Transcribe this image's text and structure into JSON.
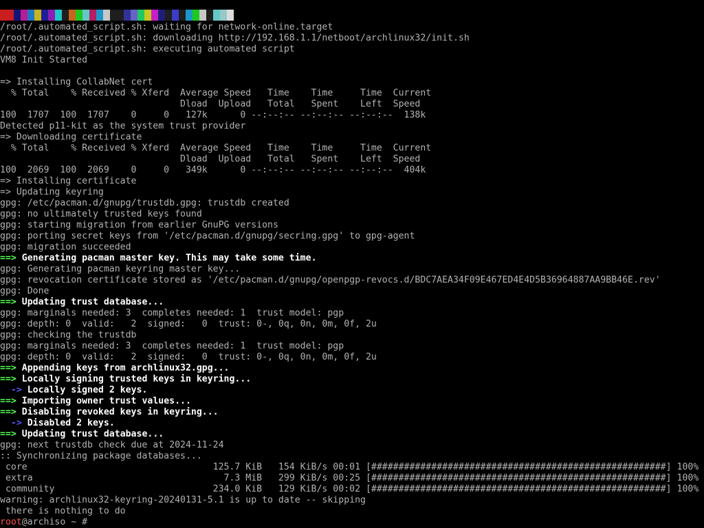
{
  "screen": {
    "background": "#000000",
    "foreground": "#b2b2b2",
    "colors": {
      "arrow_green": "#54ff54",
      "arrow_blue": "#5454ff",
      "bold_white": "#ffffff",
      "prompt_red": "#ff5454"
    }
  },
  "boot_color_bar": [
    "#c81e1e",
    "#c81e1e",
    "#141478",
    "#b41e96",
    "#1e78c8",
    "#c8b41e",
    "#1e1e96",
    "#8c1eb4",
    "#1ec8c8",
    "#1e1e1e",
    "#c8641e",
    "#1ec81e",
    "#64c8c8",
    "#b41e64",
    "#1e96c8",
    "#c8c8c8",
    "#1e1e1e",
    "#1e1e1e",
    "#323296",
    "#6464c8",
    "#1ec864",
    "#c8c81e",
    "#c81ec8",
    "#1e1e78",
    "#1e1e1e",
    "#3c3cc8",
    "#1e1e1e",
    "#1e96c8",
    "#1ec81e",
    "#c8c8c8",
    "#1e1e1e",
    "#64c8c8",
    "#96c8c8",
    "#dcdcdc"
  ],
  "lines": [
    {
      "t": "/root/.automated_script.sh: waiting for network-online.target"
    },
    {
      "t": "/root/.automated_script.sh: downloading http://192.168.1.1/netboot/archlinux32/init.sh"
    },
    {
      "t": "/root/.automated_script.sh: executing automated script"
    },
    {
      "t": "VM8 Init Started"
    },
    {
      "t": ""
    },
    {
      "t": "=> Installing CollabNet cert"
    },
    {
      "t": "  % Total    % Received % Xferd  Average Speed   Time    Time     Time  Current"
    },
    {
      "t": "                                 Dload  Upload   Total   Spent    Left  Speed"
    },
    {
      "t": "100  1707  100  1707    0     0   127k      0 --:--:-- --:--:-- --:--:--  138k"
    },
    {
      "t": "Detected p11-kit as the system trust provider"
    },
    {
      "t": "=> Downloading certificate"
    },
    {
      "t": "  % Total    % Received % Xferd  Average Speed   Time    Time     Time  Current"
    },
    {
      "t": "                                 Dload  Upload   Total   Spent    Left  Speed"
    },
    {
      "t": "100  2069  100  2069    0     0   349k      0 --:--:-- --:--:-- --:--:--  404k"
    },
    {
      "t": "=> Installing certificate"
    },
    {
      "t": "=> Updating keyring"
    },
    {
      "t": "gpg: /etc/pacman.d/gnupg/trustdb.gpg: trustdb created"
    },
    {
      "t": "gpg: no ultimately trusted keys found"
    },
    {
      "t": "gpg: starting migration from earlier GnuPG versions"
    },
    {
      "t": "gpg: porting secret keys from '/etc/pacman.d/gnupg/secring.gpg' to gpg-agent"
    },
    {
      "t": "gpg: migration succeeded"
    },
    {
      "p": "==>",
      "pc": "g",
      "t": " Generating pacman master key. This may take some time.",
      "tc": "b"
    },
    {
      "t": "gpg: Generating pacman keyring master key..."
    },
    {
      "t": "gpg: revocation certificate stored as '/etc/pacman.d/gnupg/openpgp-revocs.d/BDC7AEA34F09E467ED4E4D5B36964887AA9BB46E.rev'"
    },
    {
      "t": "gpg: Done"
    },
    {
      "p": "==>",
      "pc": "g",
      "t": " Updating trust database...",
      "tc": "b"
    },
    {
      "t": "gpg: marginals needed: 3  completes needed: 1  trust model: pgp"
    },
    {
      "t": "gpg: depth: 0  valid:   2  signed:   0  trust: 0-, 0q, 0n, 0m, 0f, 2u"
    },
    {
      "t": "gpg: checking the trustdb"
    },
    {
      "t": "gpg: marginals needed: 3  completes needed: 1  trust model: pgp"
    },
    {
      "t": "gpg: depth: 0  valid:   2  signed:   0  trust: 0-, 0q, 0n, 0m, 0f, 2u"
    },
    {
      "p": "==>",
      "pc": "g",
      "t": " Appending keys from archlinux32.gpg...",
      "tc": "b"
    },
    {
      "p": "==>",
      "pc": "g",
      "t": " Locally signing trusted keys in keyring...",
      "tc": "b"
    },
    {
      "pre": "  ",
      "p": "->",
      "pc": "bl",
      "t": " Locally signed 2 keys.",
      "tc": "b"
    },
    {
      "p": "==>",
      "pc": "g",
      "t": " Importing owner trust values...",
      "tc": "b"
    },
    {
      "p": "==>",
      "pc": "g",
      "t": " Disabling revoked keys in keyring...",
      "tc": "b"
    },
    {
      "pre": "  ",
      "p": "->",
      "pc": "bl",
      "t": " Disabled 2 keys.",
      "tc": "b"
    },
    {
      "p": "==>",
      "pc": "g",
      "t": " Updating trust database...",
      "tc": "b"
    },
    {
      "t": "gpg: next trustdb check due at 2024-11-24"
    },
    {
      "t": ":: Synchronizing package databases..."
    },
    {
      "t": " core                                  125.7 KiB   154 KiB/s 00:01 [######################################################] 100%"
    },
    {
      "t": " extra                                   7.3 MiB   299 KiB/s 00:25 [######################################################] 100%"
    },
    {
      "t": " community                             234.0 KiB   129 KiB/s 00:02 [######################################################] 100%"
    },
    {
      "t": "warning: archlinux32-keyring-20240131-5.1 is up to date -- skipping"
    },
    {
      "t": " there is nothing to do"
    },
    {
      "p": "root",
      "pc": "r",
      "t": "@archiso ~ #"
    }
  ]
}
